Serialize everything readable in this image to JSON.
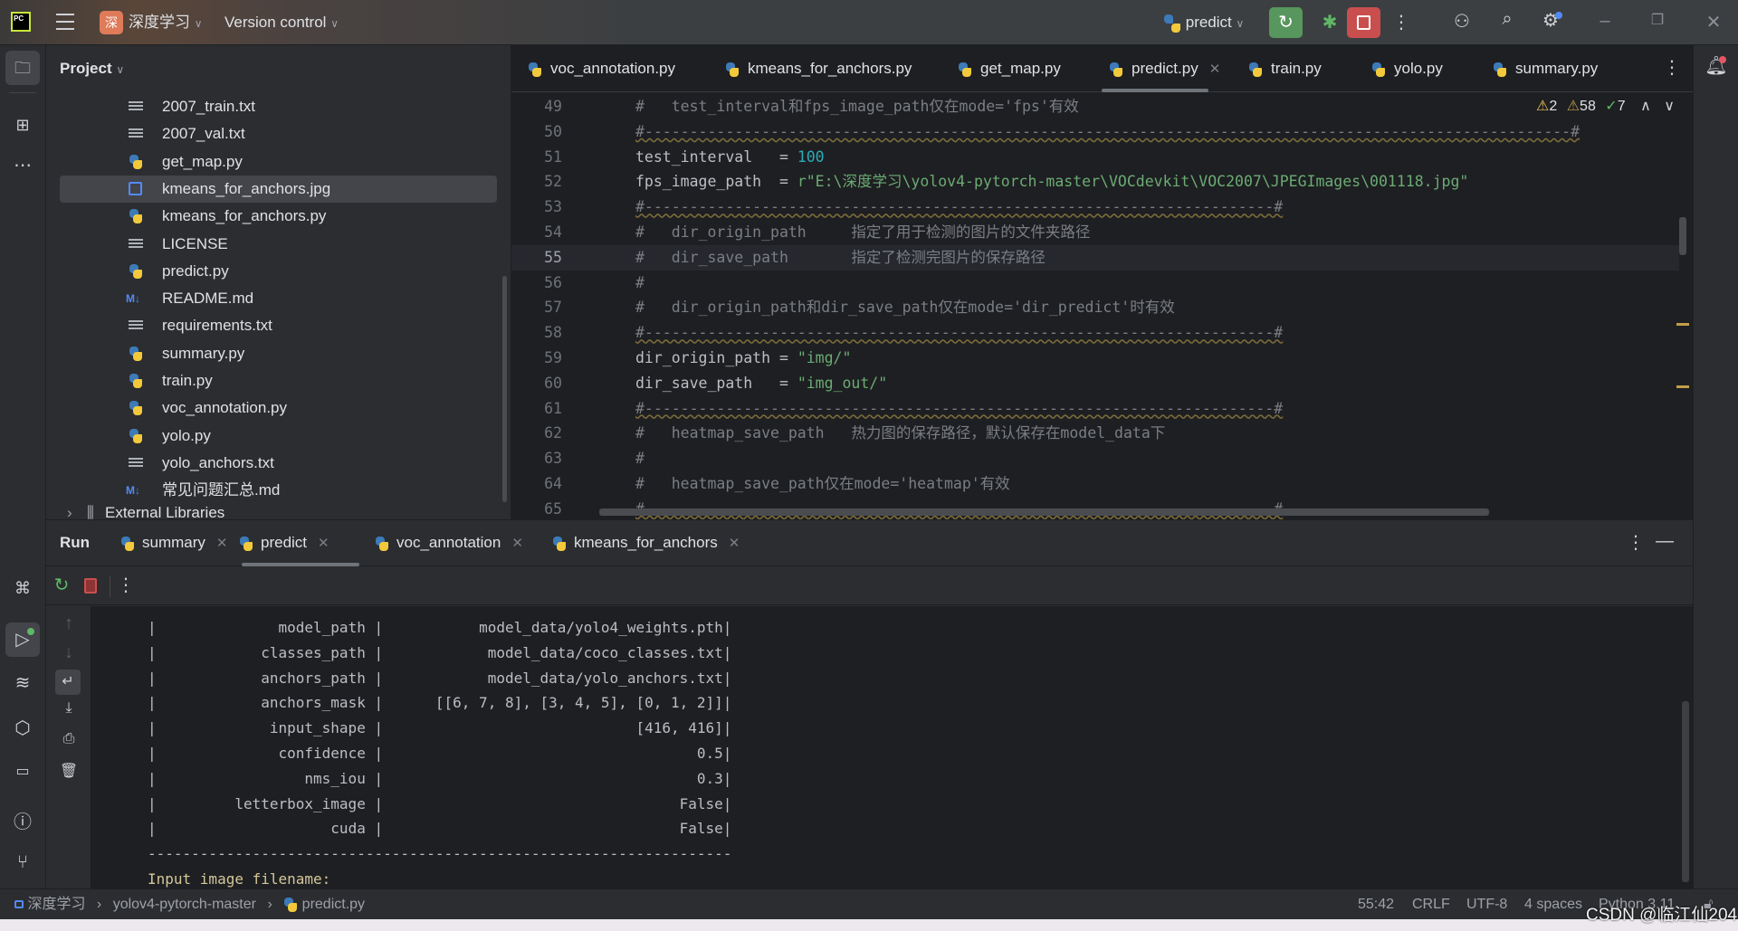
{
  "titlebar": {
    "project_badge": "深",
    "project_name": "深度学习",
    "vcs": "Version control",
    "run_config": "predict",
    "colors": {
      "run": "#57965c",
      "stop": "#c94f4f",
      "badge": "#e07b5a"
    }
  },
  "project_panel": {
    "title": "Project",
    "items": [
      {
        "label": "2007_train.txt",
        "icon": "text-file-icon"
      },
      {
        "label": "2007_val.txt",
        "icon": "text-file-icon"
      },
      {
        "label": "get_map.py",
        "icon": "python-file-icon"
      },
      {
        "label": "kmeans_for_anchors.jpg",
        "icon": "image-file-icon",
        "selected": true
      },
      {
        "label": "kmeans_for_anchors.py",
        "icon": "python-file-icon"
      },
      {
        "label": "LICENSE",
        "icon": "text-file-icon"
      },
      {
        "label": "predict.py",
        "icon": "python-file-icon"
      },
      {
        "label": "README.md",
        "icon": "markdown-file-icon"
      },
      {
        "label": "requirements.txt",
        "icon": "text-file-icon"
      },
      {
        "label": "summary.py",
        "icon": "python-file-icon"
      },
      {
        "label": "train.py",
        "icon": "python-file-icon"
      },
      {
        "label": "voc_annotation.py",
        "icon": "python-file-icon"
      },
      {
        "label": "yolo.py",
        "icon": "python-file-icon"
      },
      {
        "label": "yolo_anchors.txt",
        "icon": "text-file-icon"
      },
      {
        "label": "常见问题汇总.md",
        "icon": "markdown-file-icon"
      }
    ],
    "external": "External Libraries",
    "md_badge": "M↓"
  },
  "editor": {
    "tabs": [
      "voc_annotation.py",
      "kmeans_for_anchors.py",
      "get_map.py",
      "predict.py",
      "train.py",
      "yolo.py",
      "summary.py"
    ],
    "active_tab": "predict.py",
    "inspections": {
      "warnings": "2",
      "weak_warnings": "58",
      "typos": "7"
    },
    "lines": [
      {
        "n": "49",
        "segs": [
          [
            "c-com",
            "#   test_interval和fps_image_path仅在mode='fps'有效"
          ]
        ]
      },
      {
        "n": "50",
        "segs": [
          [
            "c-dash",
            "#-------------------------------------------------------------------------------------------------------#"
          ]
        ]
      },
      {
        "n": "51",
        "segs": [
          [
            "c-id",
            "test_interval   = "
          ],
          [
            "c-num",
            "100"
          ]
        ]
      },
      {
        "n": "52",
        "segs": [
          [
            "c-id",
            "fps_image_path  = "
          ],
          [
            "c-str",
            "r\"E:\\深度学习\\yolov4-pytorch-master\\VOCdevkit\\VOC2007\\JPEGImages\\001118.jpg\""
          ]
        ]
      },
      {
        "n": "53",
        "segs": [
          [
            "c-dash",
            "#----------------------------------------------------------------------#"
          ]
        ]
      },
      {
        "n": "54",
        "segs": [
          [
            "c-com",
            "#   dir_origin_path     指定了用于检测的图片的文件夹路径"
          ]
        ]
      },
      {
        "n": "55",
        "segs": [
          [
            "c-com",
            "#   dir_save_path       指定了检测完图片的保存路径"
          ]
        ],
        "current": true
      },
      {
        "n": "56",
        "segs": [
          [
            "c-com",
            "#"
          ]
        ]
      },
      {
        "n": "57",
        "segs": [
          [
            "c-com",
            "#   dir_origin_path和dir_save_path仅在mode='dir_predict'时有效"
          ]
        ]
      },
      {
        "n": "58",
        "segs": [
          [
            "c-dash",
            "#----------------------------------------------------------------------#"
          ]
        ]
      },
      {
        "n": "59",
        "segs": [
          [
            "c-id",
            "dir_origin_path = "
          ],
          [
            "c-str",
            "\"img/\""
          ]
        ]
      },
      {
        "n": "60",
        "segs": [
          [
            "c-id",
            "dir_save_path   = "
          ],
          [
            "c-str",
            "\"img_out/\""
          ]
        ]
      },
      {
        "n": "61",
        "segs": [
          [
            "c-dash",
            "#----------------------------------------------------------------------#"
          ]
        ]
      },
      {
        "n": "62",
        "segs": [
          [
            "c-com",
            "#   heatmap_save_path   热力图的保存路径，默认保存在model_data下"
          ]
        ]
      },
      {
        "n": "63",
        "segs": [
          [
            "c-com",
            "#"
          ]
        ]
      },
      {
        "n": "64",
        "segs": [
          [
            "c-com",
            "#   heatmap_save_path仅在mode='heatmap'有效"
          ]
        ]
      },
      {
        "n": "65",
        "segs": [
          [
            "c-dash",
            "#----------------------------------------------------------------------#"
          ]
        ]
      }
    ]
  },
  "run_panel": {
    "title": "Run",
    "tabs": [
      "summary",
      "predict",
      "voc_annotation",
      "kmeans_for_anchors"
    ],
    "active_tab": "predict",
    "rows": [
      {
        "key": "model_path",
        "value": "model_data/yolo4_weights.pth"
      },
      {
        "key": "classes_path",
        "value": "model_data/coco_classes.txt"
      },
      {
        "key": "anchors_path",
        "value": "model_data/yolo_anchors.txt"
      },
      {
        "key": "anchors_mask",
        "value": "[[6, 7, 8], [3, 4, 5], [0, 1, 2]]"
      },
      {
        "key": "input_shape",
        "value": "[416, 416]"
      },
      {
        "key": "confidence",
        "value": "0.5"
      },
      {
        "key": "nms_iou",
        "value": "0.3"
      },
      {
        "key": "letterbox_image",
        "value": "False"
      },
      {
        "key": "cuda",
        "value": "False"
      }
    ],
    "separator": "-------------------------------------------------------------------",
    "prompt": "Input image filename:"
  },
  "statusbar": {
    "breadcrumb": [
      "深度学习",
      "yolov4-pytorch-master",
      "predict.py"
    ],
    "position": "55:42",
    "line_sep": "CRLF",
    "encoding": "UTF-8",
    "indent": "4 spaces",
    "interpreter": "Python 3.11"
  },
  "watermark": "CSDN @临江仙204"
}
